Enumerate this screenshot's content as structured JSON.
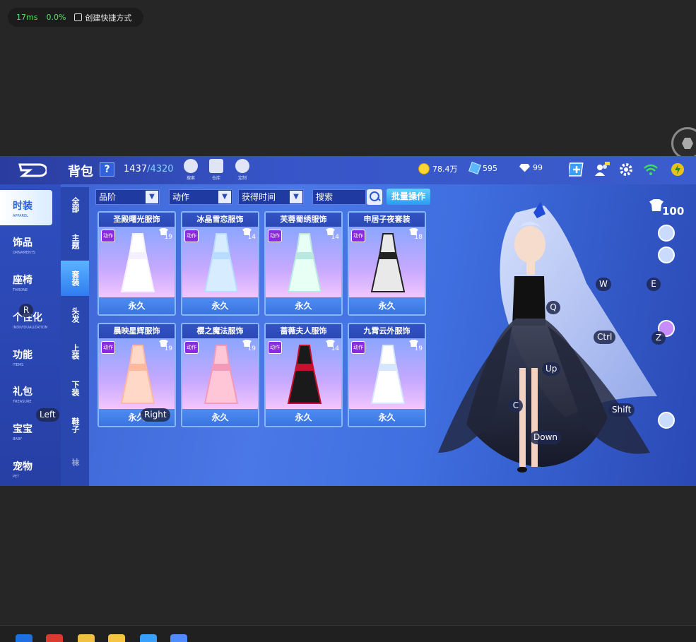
{
  "overlay": {
    "latency": "17ms",
    "loss": "0.0%",
    "shortcut_label": "创建快捷方式"
  },
  "header": {
    "title": "背包",
    "help": "?",
    "capacity_used": "1437",
    "capacity_max": "/4320",
    "tools": [
      {
        "label": "搜索",
        "icon": "search-bulb-icon"
      },
      {
        "label": "仓库",
        "icon": "warehouse-icon"
      },
      {
        "label": "定制",
        "icon": "customize-icon"
      }
    ],
    "coins": "78.4万",
    "vouchers": "595",
    "diamonds": "99"
  },
  "main_nav": [
    {
      "zh": "时装",
      "en": "APPAREL",
      "active": true
    },
    {
      "zh": "饰品",
      "en": "ORNAMENTS",
      "active": false
    },
    {
      "zh": "座椅",
      "en": "THRONE",
      "active": false
    },
    {
      "zh": "个性化",
      "en": "INDIVIDUALIZATION",
      "active": false
    },
    {
      "zh": "功能",
      "en": "ITEMS",
      "active": false
    },
    {
      "zh": "礼包",
      "en": "TREASURE",
      "active": false
    },
    {
      "zh": "宝宝",
      "en": "BABY",
      "active": false
    },
    {
      "zh": "宠物",
      "en": "PET",
      "active": false
    }
  ],
  "sub_nav": [
    {
      "label": "全部",
      "active": false
    },
    {
      "label": "主题",
      "active": false
    },
    {
      "label": "套装",
      "active": true
    },
    {
      "label": "头发",
      "active": false
    },
    {
      "label": "上装",
      "active": false
    },
    {
      "label": "下装",
      "active": false
    },
    {
      "label": "鞋子",
      "active": false
    },
    {
      "label": "袜",
      "active": false
    }
  ],
  "filters": {
    "grade": "品阶",
    "action": "动作",
    "acquired": "获得时间",
    "search_placeholder": "搜索",
    "batch": "批量操作"
  },
  "items": [
    {
      "name": "圣殿曙光服饰",
      "badge": "动作",
      "level": "19",
      "duration": "永久",
      "colors": [
        "#ffffff",
        "#f4f0ff"
      ]
    },
    {
      "name": "冰晶雪恋服饰",
      "badge": "动作",
      "level": "14",
      "duration": "永久",
      "colors": [
        "#d8ecff",
        "#b8dcff"
      ]
    },
    {
      "name": "芙蓉蜀绣服饰",
      "badge": "动作",
      "level": "14",
      "duration": "永久",
      "colors": [
        "#e8fff6",
        "#b9e8e0"
      ]
    },
    {
      "name": "申居子夜套装",
      "badge": "动作",
      "level": "18",
      "duration": "永久",
      "colors": [
        "#e9e9e9",
        "#222222"
      ]
    },
    {
      "name": "晨映星辉服饰",
      "badge": "动作",
      "level": "19",
      "duration": "永久",
      "colors": [
        "#ffd8c8",
        "#ffb8a0"
      ]
    },
    {
      "name": "樱之魔法服饰",
      "badge": "动作",
      "level": "19",
      "duration": "永久",
      "colors": [
        "#ffc6d8",
        "#f49ab8"
      ]
    },
    {
      "name": "蔷薇夫人服饰",
      "badge": "动作",
      "level": "14",
      "duration": "永久",
      "colors": [
        "#1a1a1a",
        "#c8102e"
      ]
    },
    {
      "name": "九霄云外服饰",
      "badge": "动作",
      "level": "19",
      "duration": "永久",
      "colors": [
        "#ffffff",
        "#d6e6ff"
      ]
    }
  ],
  "hud": {
    "shirt_count": "100",
    "keys": {
      "w": "W",
      "e": "E",
      "q": "Q",
      "ctrl": "Ctrl",
      "z": "Z",
      "up": "Up",
      "c": "C",
      "shift": "Shift",
      "down": "Down",
      "r": "R",
      "left": "Left",
      "right": "Right"
    }
  }
}
